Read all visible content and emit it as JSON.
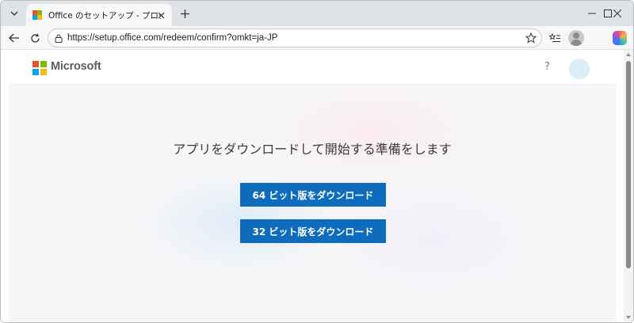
{
  "browser": {
    "tab_title": "Office のセットアップ - プロダクト キーの",
    "url": "https://setup.office.com/redeem/confirm?omkt=ja-JP"
  },
  "page": {
    "brand": "Microsoft",
    "help_label": "?",
    "headline": "アプリをダウンロードして開始する準備をします",
    "download_64_label": "64 ビット版をダウンロード",
    "download_32_label": "32 ビット版をダウンロード"
  },
  "colors": {
    "ms_red": "#f25022",
    "ms_green": "#7fba00",
    "ms_blue": "#00a4ef",
    "ms_yellow": "#ffb900",
    "button_blue": "#0f6cbd"
  },
  "icons": {
    "tab_menu": "chevron-down-icon",
    "new_tab": "plus-icon",
    "back": "back-arrow-icon",
    "refresh": "refresh-icon",
    "lock": "lock-icon",
    "favorite": "star-icon",
    "collections": "favorites-list-icon",
    "profile": "profile-icon",
    "copilot": "copilot-icon"
  }
}
